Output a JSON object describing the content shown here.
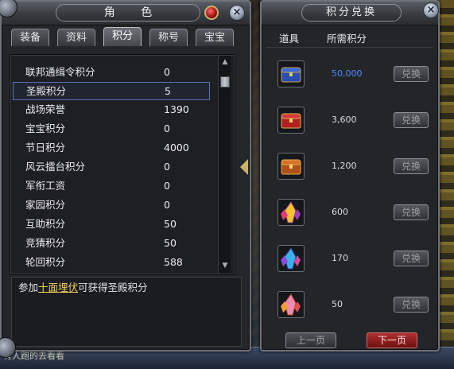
{
  "character_panel": {
    "title": "角 色",
    "tabs": [
      {
        "label": "装备"
      },
      {
        "label": "资料"
      },
      {
        "label": "积分"
      },
      {
        "label": "称号"
      },
      {
        "label": "宝宝"
      }
    ],
    "active_tab": "积分",
    "rows": [
      {
        "label": "联邦通缉令积分",
        "value": "0"
      },
      {
        "label": "圣殿积分",
        "value": "5"
      },
      {
        "label": "战场荣誉",
        "value": "1390"
      },
      {
        "label": "宝宝积分",
        "value": "0"
      },
      {
        "label": "节日积分",
        "value": "4000"
      },
      {
        "label": "风云擂台积分",
        "value": "0"
      },
      {
        "label": "军衔工资",
        "value": "0"
      },
      {
        "label": "家园积分",
        "value": "0"
      },
      {
        "label": "互助积分",
        "value": "50"
      },
      {
        "label": "竞猜积分",
        "value": "50"
      },
      {
        "label": "轮回积分",
        "value": "588"
      }
    ],
    "selected_row": "圣殿积分",
    "description": {
      "prefix": "参加",
      "link": "十面埋伏",
      "suffix": "可获得圣殿积分"
    }
  },
  "exchange_panel": {
    "title": "积分兑换",
    "col_item": "道具",
    "col_cost": "所需积分",
    "items": [
      {
        "icon": "blue-chest-icon",
        "cost": "50,000",
        "cost_color": "#4a8cff",
        "button": "兑换"
      },
      {
        "icon": "red-chest-icon",
        "cost": "3,600",
        "cost_color": "#dcdcdc",
        "button": "兑换"
      },
      {
        "icon": "orange-chest-icon",
        "cost": "1,200",
        "cost_color": "#dcdcdc",
        "button": "兑换"
      },
      {
        "icon": "yellow-crystal-icon",
        "cost": "600",
        "cost_color": "#dcdcdc",
        "button": "兑换"
      },
      {
        "icon": "blue-crystal-icon",
        "cost": "170",
        "cost_color": "#dcdcdc",
        "button": "兑换"
      },
      {
        "icon": "pink-crystal-icon",
        "cost": "50",
        "cost_color": "#dcdcdc",
        "button": "兑换"
      }
    ],
    "prev_page": "上一页",
    "next_page": "下一页"
  },
  "bottom_text": "有人跑的去看看"
}
